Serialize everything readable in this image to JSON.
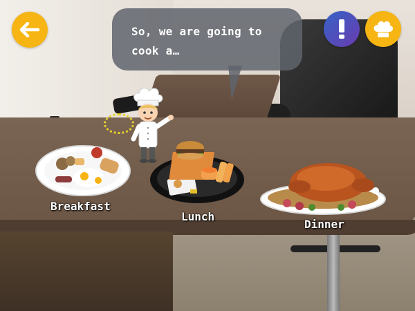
{
  "speech_bubble": {
    "line1": "So, we are going to",
    "line2": "cook a…"
  },
  "meals": {
    "breakfast": {
      "label": "Breakfast"
    },
    "lunch": {
      "label": "Lunch"
    },
    "dinner": {
      "label": "Dinner"
    }
  },
  "buttons": {
    "back_icon": "arrow-left-icon",
    "info_icon": "exclamation-icon",
    "chef_icon": "chef-hat-icon"
  },
  "colors": {
    "accent_yellow": "#f6b512",
    "info_blue": "#3563c6",
    "bubble_gray": "#5f646c",
    "label_white": "#ffffff"
  }
}
